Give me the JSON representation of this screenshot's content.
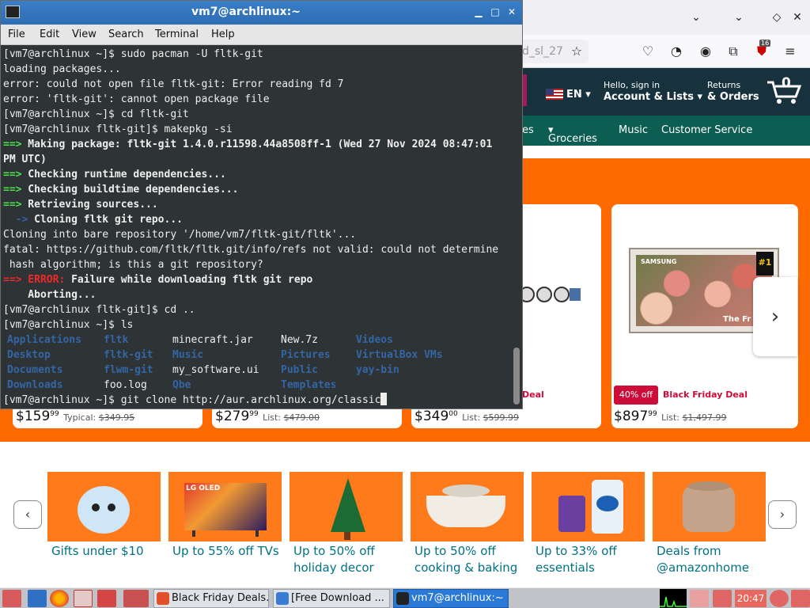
{
  "terminal": {
    "title": "vm7@archlinux:~",
    "menu": [
      "File",
      "Edit",
      "View",
      "Search",
      "Terminal",
      "Help"
    ],
    "lines": [
      {
        "t": "[vm7@archlinux ~]$ sudo pacman -U fltk-git",
        "cls": ""
      },
      {
        "t": "loading packages...",
        "cls": ""
      },
      {
        "t": "error: could not open file fltk-git: Error reading fd 7",
        "cls": ""
      },
      {
        "t": "error: 'fltk-git': cannot open package file",
        "cls": ""
      },
      {
        "t": "[vm7@archlinux ~]$ cd fltk-git",
        "cls": ""
      },
      {
        "t": "[vm7@archlinux fltk-git]$ makepkg -si",
        "cls": ""
      },
      {
        "p": "==>",
        "t": " Making package: fltk-git 1.4.0.r11598.44a8508ff-1 (Wed 27 Nov 2024 08:47:01",
        "cls": "g"
      },
      {
        "t": "PM UTC)",
        "cls": "b"
      },
      {
        "p": "==>",
        "t": " Checking runtime dependencies...",
        "cls": "g"
      },
      {
        "p": "==>",
        "t": " Checking buildtime dependencies...",
        "cls": "g"
      },
      {
        "p": "==>",
        "t": " Retrieving sources...",
        "cls": "g"
      },
      {
        "p": "  ->",
        "t": " Cloning fltk git repo...",
        "cls": "g2"
      },
      {
        "t": "Cloning into bare repository '/home/vm7/fltk-git/fltk'...",
        "cls": ""
      },
      {
        "t": "fatal: https://github.com/fltk/fltk.git/info/refs not valid: could not determine",
        "cls": ""
      },
      {
        "t": " hash algorithm; is this a git repository?",
        "cls": ""
      },
      {
        "p": "==> ERROR:",
        "t": " Failure while downloading fltk git repo",
        "cls": "r"
      },
      {
        "t": "    Aborting...",
        "cls": "b"
      },
      {
        "t": "[vm7@archlinux fltk-git]$ cd ..",
        "cls": ""
      },
      {
        "t": "[vm7@archlinux ~]$ ls",
        "cls": ""
      }
    ],
    "ls_entries": [
      {
        "name": "Applications",
        "dir": true,
        "col": 0,
        "row": 0
      },
      {
        "name": "fltk",
        "dir": true,
        "col": 1,
        "row": 0
      },
      {
        "name": "minecraft.jar",
        "dir": false,
        "col": 2,
        "row": 0
      },
      {
        "name": "New.7z",
        "dir": false,
        "col": 3,
        "row": 0
      },
      {
        "name": "Videos",
        "dir": true,
        "col": 4,
        "row": 0
      },
      {
        "name": "Desktop",
        "dir": true,
        "col": 0,
        "row": 1
      },
      {
        "name": "fltk-git",
        "dir": true,
        "col": 1,
        "row": 1
      },
      {
        "name": "Music",
        "dir": true,
        "col": 2,
        "row": 1
      },
      {
        "name": "Pictures",
        "dir": true,
        "col": 3,
        "row": 1
      },
      {
        "name": "VirtualBox VMs",
        "dir": true,
        "col": 4,
        "row": 1
      },
      {
        "name": "Documents",
        "dir": true,
        "col": 0,
        "row": 2
      },
      {
        "name": "flwm-git",
        "dir": true,
        "col": 1,
        "row": 2
      },
      {
        "name": "my_software.ui",
        "dir": false,
        "col": 2,
        "row": 2
      },
      {
        "name": "Public",
        "dir": true,
        "col": 3,
        "row": 2
      },
      {
        "name": "yay-bin",
        "dir": true,
        "col": 4,
        "row": 2
      },
      {
        "name": "Downloads",
        "dir": true,
        "col": 0,
        "row": 3
      },
      {
        "name": "foo.log",
        "dir": false,
        "col": 1,
        "row": 3
      },
      {
        "name": "Qbe",
        "dir": true,
        "col": 2,
        "row": 3
      },
      {
        "name": "Templates",
        "dir": true,
        "col": 3,
        "row": 3
      }
    ],
    "prompt_line": "[vm7@archlinux ~]$ git clone http://aur.archlinux.org/classic"
  },
  "browser": {
    "url_fragment": "d_sl_27",
    "notifications_count": "16",
    "amazon": {
      "lang": "EN",
      "account_small": "Hello, sign in",
      "account_big": "Account & Lists",
      "returns_small": "Returns",
      "returns_big": "& Orders",
      "cart_count": "0",
      "nav": [
        "es",
        "Groceries",
        "Music",
        "Customer Service"
      ],
      "tv_brand": "SAMSUNG",
      "tv_badge": "#1",
      "tv_tag": "The Fr",
      "deal_label_1": "Deal",
      "off_badge": "40% off",
      "deal_label_2": "Black Friday Deal",
      "prices": [
        {
          "whole": "$159",
          "cents": "99",
          "list_label": "Typical:",
          "list": "$349.95"
        },
        {
          "whole": "$279",
          "cents": "99",
          "list_label": "List:",
          "list": "$479.00"
        },
        {
          "whole": "$349",
          "cents": "00",
          "list_label": "List:",
          "list": "$599.99"
        },
        {
          "whole": "$897",
          "cents": "99",
          "list_label": "List:",
          "list": "$1,497.99"
        }
      ],
      "categories": [
        {
          "label": "Gifts under $10"
        },
        {
          "label": "Up to 55% off TVs"
        },
        {
          "label": "Up to 50% off holiday decor"
        },
        {
          "label": "Up to 50% off cooking & baking"
        },
        {
          "label": "Up to 33% off essentials"
        },
        {
          "label": "Deals from @amazonhome"
        }
      ],
      "lg_text": "LG OLED"
    }
  },
  "taskbar": {
    "tasks": [
      {
        "label": "Black Friday Deals...",
        "active": false
      },
      {
        "label": "[Free Download ...",
        "active": false
      },
      {
        "label": "vm7@archlinux:~",
        "active": true
      }
    ],
    "clock": "20:47"
  }
}
